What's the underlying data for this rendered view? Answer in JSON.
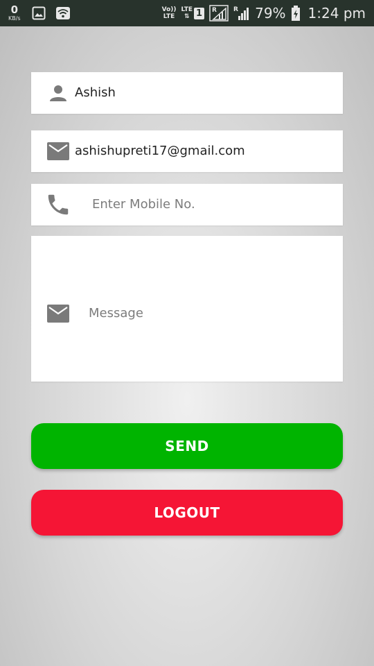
{
  "status_bar": {
    "data_rate_value": "0",
    "data_rate_unit": "KB/s",
    "volte_top": "Vo))",
    "volte_bottom": "LTE",
    "lte_label": "LTE",
    "sim_number": "1",
    "roaming_label": "R",
    "roaming_label_2": "R",
    "battery_percent": "79%",
    "time": "1:24 pm"
  },
  "form": {
    "name_value": "Ashish",
    "email_value": "ashishupreti17@gmail.com",
    "mobile_placeholder": "Enter Mobile No.",
    "message_placeholder": "Message"
  },
  "buttons": {
    "send_label": "SEND",
    "send_color": "#00b400",
    "logout_label": "LOGOUT",
    "logout_color": "#f51535"
  },
  "icons": {
    "name": "person-icon",
    "email": "email-icon",
    "mobile": "phone-icon",
    "message": "email-icon"
  }
}
